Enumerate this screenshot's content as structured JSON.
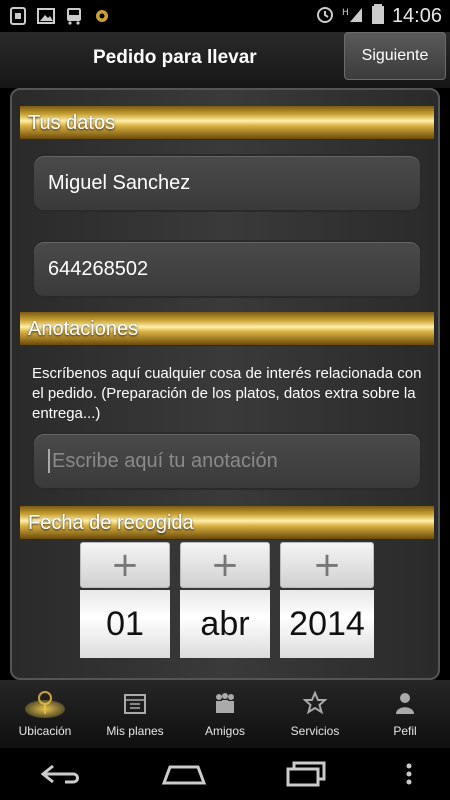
{
  "status": {
    "time": "14:06"
  },
  "header": {
    "title": "Pedido para llevar",
    "next_label": "Siguiente"
  },
  "sections": {
    "tus_datos": "Tus datos",
    "anotaciones": "Anotaciones",
    "fecha": "Fecha de recogida"
  },
  "form": {
    "name_value": "Miguel Sanchez",
    "phone_value": "644268502",
    "note_description": "Escríbenos aquí cualquier cosa de interés relacionada con el pedido. (Preparación de los platos, datos extra sobre la entrega...)",
    "note_placeholder": "Escribe aquí tu anotación"
  },
  "date": {
    "day": "01",
    "month": "abr",
    "year": "2014",
    "plus": "+"
  },
  "tabs": [
    {
      "label": "Ubicación",
      "icon": "location-icon",
      "active": true
    },
    {
      "label": "Mis planes",
      "icon": "calendar-icon",
      "active": false
    },
    {
      "label": "Amigos",
      "icon": "friends-icon",
      "active": false
    },
    {
      "label": "Servicios",
      "icon": "star-icon",
      "active": false
    },
    {
      "label": "Pefil",
      "icon": "profile-icon",
      "active": false
    }
  ],
  "colors": {
    "gold": "#c9a236",
    "panel": "#333333"
  }
}
